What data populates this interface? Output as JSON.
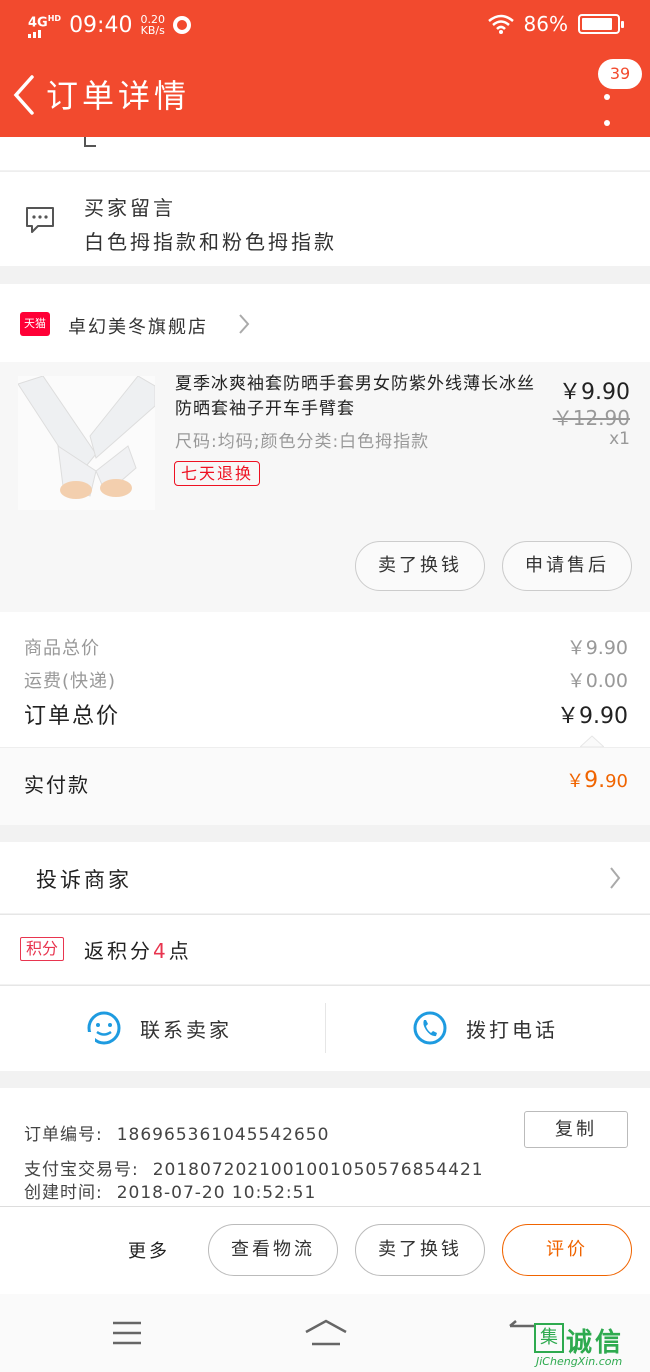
{
  "status_bar": {
    "network": "4G",
    "network_sup": "HD",
    "time": "09:40",
    "speed_value": "0.20",
    "speed_unit": "KB/s",
    "battery": "86%"
  },
  "nav": {
    "title": "订单详情",
    "message_count": "39"
  },
  "buyer_message": {
    "title": "买家留言",
    "text": "白色拇指款和粉色拇指款"
  },
  "shop": {
    "platform_badge": "天猫",
    "name": "卓幻美冬旗舰店"
  },
  "product": {
    "title": "夏季冰爽袖套防晒手套男女防紫外线薄长冰丝防晒套袖子开车手臂套",
    "spec": "尺码:均码;颜色分类:白色拇指款",
    "tag": "七天退换",
    "price": "￥9.90",
    "original_price": "￥12.90",
    "quantity": "x1",
    "actions": [
      "卖了换钱",
      "申请售后"
    ]
  },
  "summary": {
    "goods_total_label": "商品总价",
    "goods_total_value": "￥9.90",
    "shipping_label": "运费(快递)",
    "shipping_value": "￥0.00",
    "order_total_label": "订单总价",
    "order_total_value": "￥9.90",
    "paid_label": "实付款",
    "paid_symbol": "￥",
    "paid_int": "9.",
    "paid_dec": "90"
  },
  "complaint": {
    "label": "投诉商家"
  },
  "points": {
    "badge": "积分",
    "prefix": "返积分",
    "value": "4",
    "suffix": "点"
  },
  "contact": {
    "seller_label": "联系卖家",
    "call_label": "拨打电话"
  },
  "order_info": {
    "order_no_label": "订单编号:",
    "order_no": "1869653610455426​50",
    "copy_label": "复制",
    "alipay_label": "支付宝交易号:",
    "alipay_no": "2018072021001001050576854421",
    "created_label": "创建时间:",
    "created_at": "2018-07-20 10:52:51"
  },
  "bottom_actions": {
    "more": "更多",
    "logistics": "查看物流",
    "resell": "卖了换钱",
    "review": "评价"
  },
  "watermark": {
    "box": "集",
    "title": "诚信",
    "url": "JiChengXin.com"
  },
  "colors": {
    "header": "#f24a2e",
    "accent": "#f06400",
    "tmall": "#ff0036",
    "points": "#e8354f",
    "contact_icon": "#1e9be0"
  }
}
